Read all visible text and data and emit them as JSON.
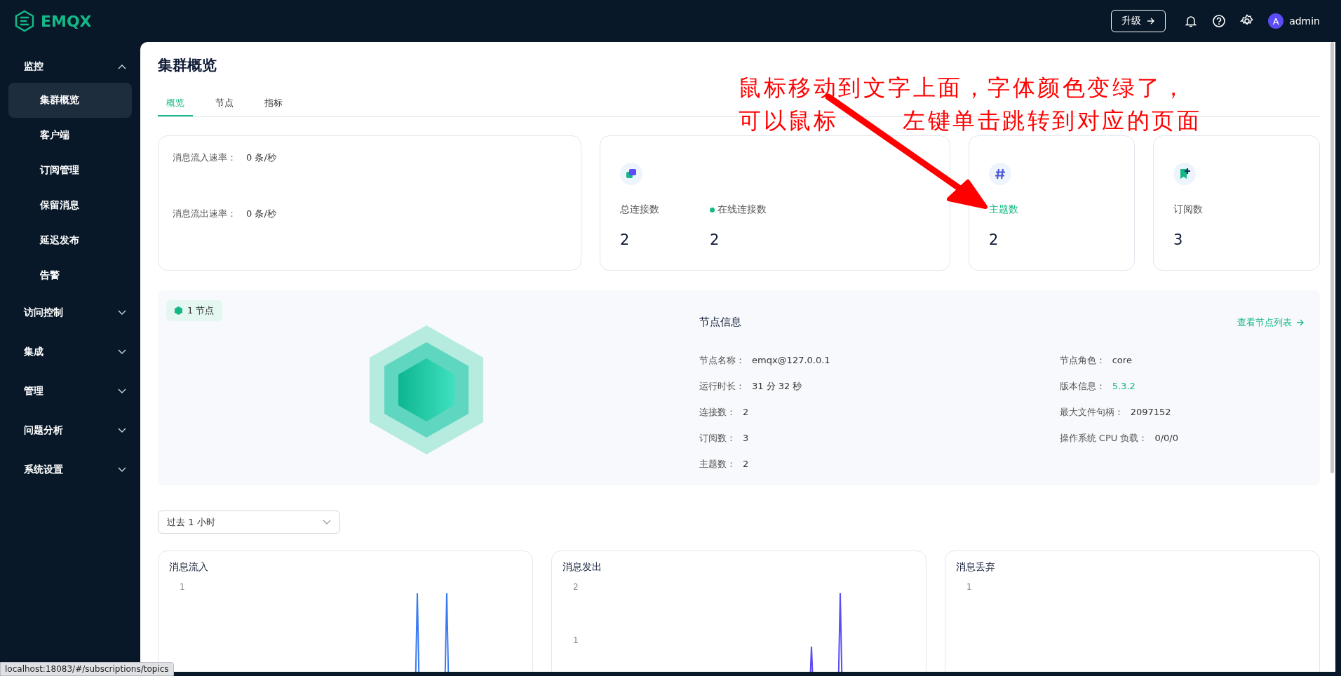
{
  "topbar": {
    "logo": "EMQX",
    "upgrade_button": "升级",
    "user_avatar": "A",
    "user_name": "admin"
  },
  "sidebar": {
    "items": [
      {
        "label": "监控",
        "expanded": true,
        "children": [
          {
            "label": "集群概览",
            "selected": true
          },
          {
            "label": "客户端",
            "selected": false
          },
          {
            "label": "订阅管理",
            "selected": false
          },
          {
            "label": "保留消息",
            "selected": false
          },
          {
            "label": "延迟发布",
            "selected": false
          },
          {
            "label": "告警",
            "selected": false
          }
        ]
      },
      {
        "label": "访问控制",
        "expanded": false
      },
      {
        "label": "集成",
        "expanded": false
      },
      {
        "label": "管理",
        "expanded": false
      },
      {
        "label": "问题分析",
        "expanded": false
      },
      {
        "label": "系统设置",
        "expanded": false
      }
    ]
  },
  "page": {
    "title": "集群概览",
    "tabs": [
      {
        "label": "概览",
        "selected": true
      },
      {
        "label": "节点",
        "selected": false
      },
      {
        "label": "指标",
        "selected": false
      }
    ]
  },
  "rates": [
    {
      "label": "消息流入速率：",
      "value": "0 条/秒"
    },
    {
      "label": "消息流出速率：",
      "value": "0 条/秒"
    }
  ],
  "stats": [
    {
      "kind": "connections",
      "items": [
        {
          "label": "总连接数",
          "value": "2",
          "online_dot": false,
          "hovered": false
        },
        {
          "label": "在线连接数",
          "value": "2",
          "online_dot": true,
          "hovered": false
        }
      ]
    },
    {
      "kind": "topics",
      "items": [
        {
          "label": "主题数",
          "value": "2",
          "online_dot": false,
          "hovered": true
        }
      ]
    },
    {
      "kind": "subscriptions",
      "items": [
        {
          "label": "订阅数",
          "value": "3",
          "online_dot": false,
          "hovered": false
        }
      ]
    }
  ],
  "node": {
    "badge": "1 节点",
    "title": "节点信息",
    "link": "查看节点列表",
    "fields_left": [
      {
        "label": "节点名称：",
        "value": "emqx@127.0.0.1",
        "highlight": false
      },
      {
        "label": "运行时长：",
        "value": "31 分 32 秒",
        "highlight": false
      },
      {
        "label": "连接数：",
        "value": "2",
        "highlight": false
      },
      {
        "label": "订阅数：",
        "value": "3",
        "highlight": false
      },
      {
        "label": "主题数：",
        "value": "2",
        "highlight": false
      }
    ],
    "fields_right": [
      {
        "label": "节点角色：",
        "value": "core",
        "highlight": false
      },
      {
        "label": "版本信息：",
        "value": "5.3.2",
        "highlight": true
      },
      {
        "label": "最大文件句柄：",
        "value": "2097152",
        "highlight": false
      },
      {
        "label": "操作系统 CPU 负载：",
        "value": "0/0/0",
        "highlight": false
      }
    ]
  },
  "time_range": {
    "value": "过去 1 小时"
  },
  "charts": [
    {
      "title": "消息流入",
      "y_ticks": [
        "1"
      ]
    },
    {
      "title": "消息发出",
      "y_ticks": [
        "2",
        "1"
      ]
    },
    {
      "title": "消息丢弃",
      "y_ticks": [
        "1"
      ]
    }
  ],
  "annotation": {
    "line_1": "鼠标移动到文字上面，字体颜色变绿了，",
    "line_2": [
      "可以鼠标",
      "左键单击跳转到对应的页面"
    ]
  },
  "status_tooltip": "localhost:18083/#/subscriptions/topics"
}
